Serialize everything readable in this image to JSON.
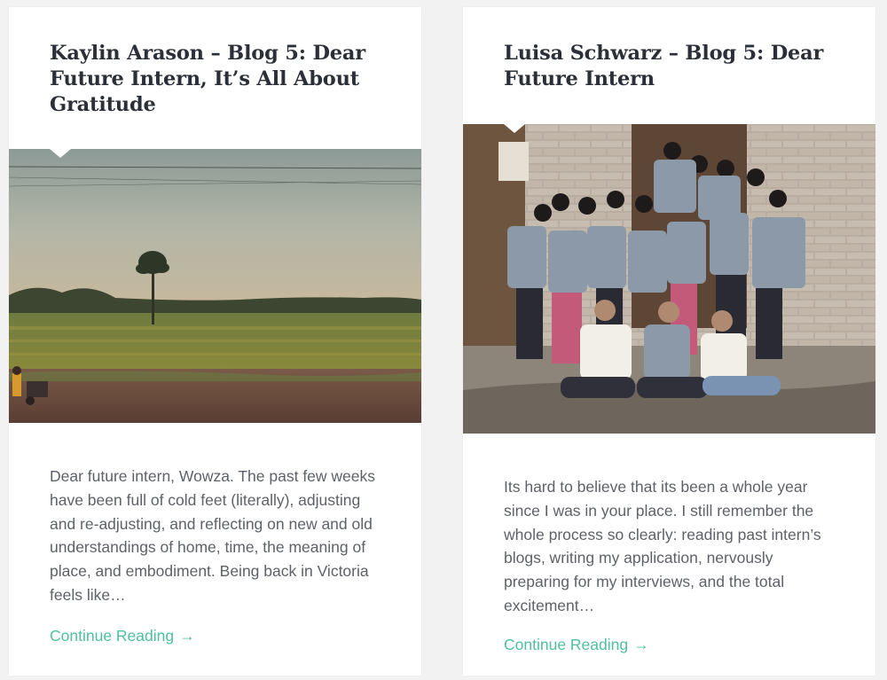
{
  "posts": [
    {
      "title": "Kaylin Arason – Blog 5: Dear Future Intern, It’s All About Gratitude",
      "excerpt": "Dear future intern, Wowza. The past few weeks have been full of cold feet (literally), adjusting and re-adjusting, and reflecting on new and old understandings of home, time, the meaning of place, and embodiment. Being back in Victoria feels like…",
      "read_more": "Continue Reading",
      "arrow": "→"
    },
    {
      "title": "Luisa Schwarz – Blog 5: Dear Future Intern",
      "excerpt": "Its hard to believe that its been a whole year since I was in your place. I still remember the whole process so clearly: reading past intern’s blogs, writing my application, nervously preparing for my interviews, and the total excitement…",
      "read_more": "Continue Reading",
      "arrow": "→"
    }
  ],
  "colors": {
    "title": "#2b3038",
    "excerpt": "#5e6268",
    "link": "#4fbf9f",
    "card": "#ffffff",
    "page": "#f2f2f2"
  }
}
